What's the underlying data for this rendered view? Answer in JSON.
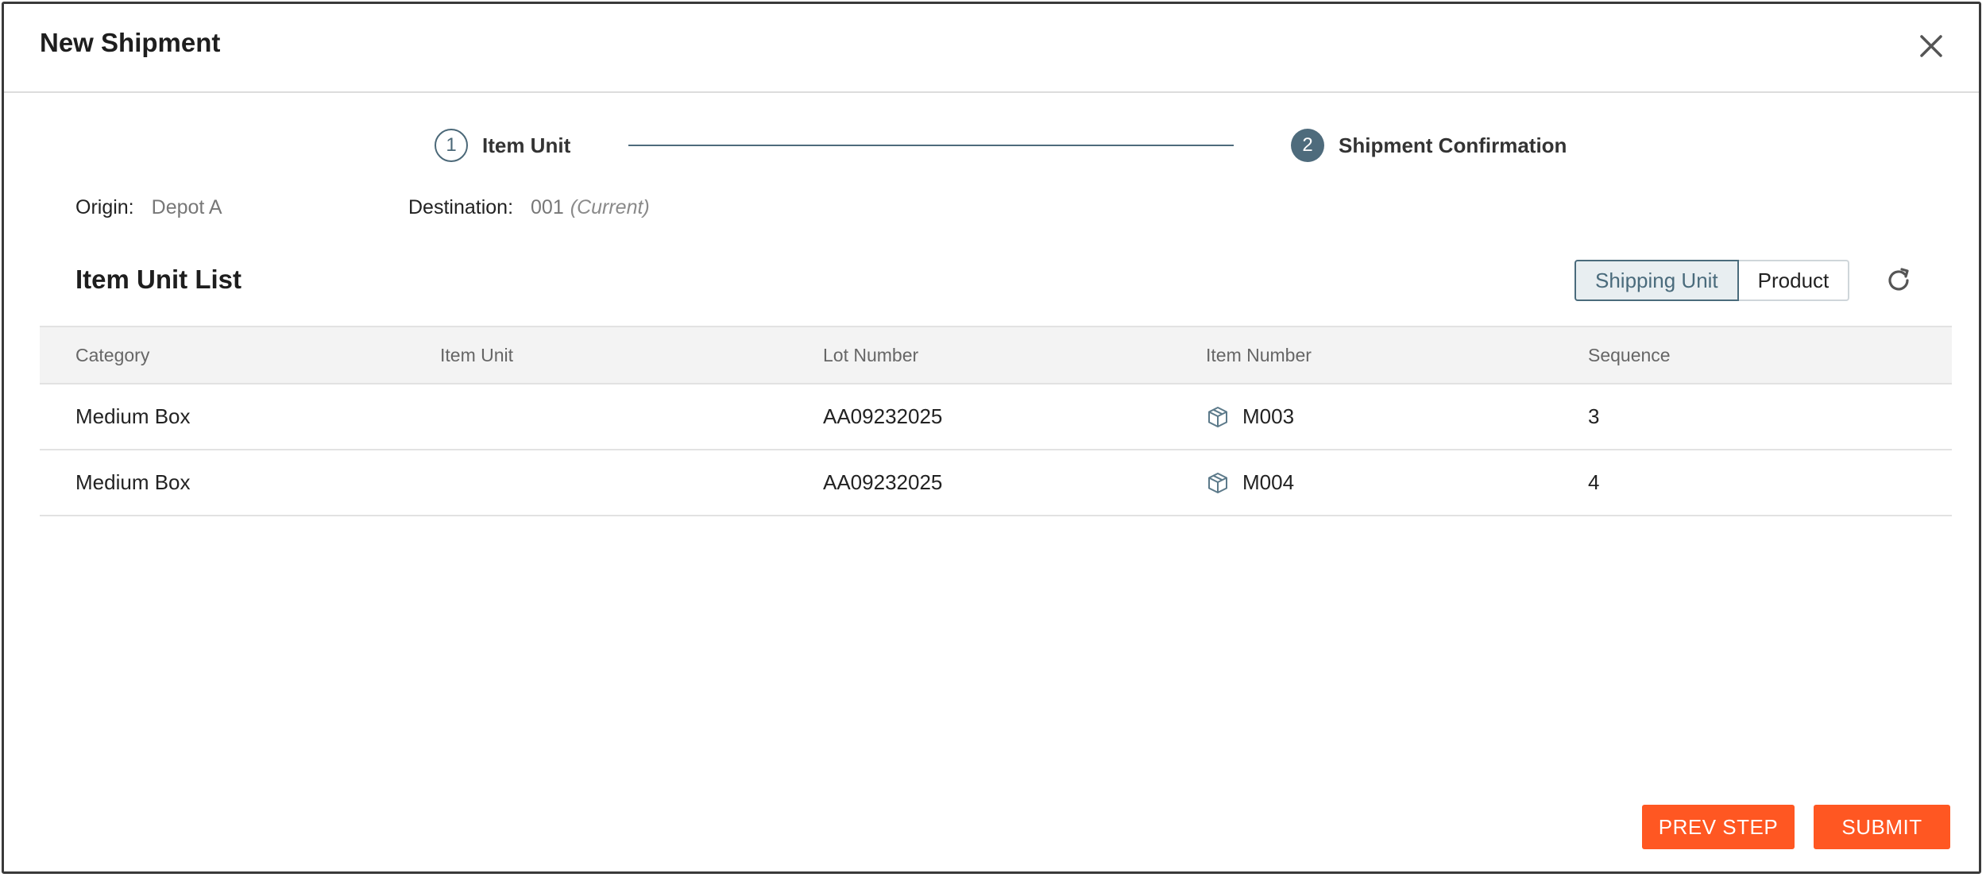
{
  "dialog": {
    "title": "New Shipment"
  },
  "stepper": {
    "steps": [
      {
        "number": "1",
        "label": "Item Unit"
      },
      {
        "number": "2",
        "label": "Shipment Confirmation"
      }
    ]
  },
  "meta": {
    "origin_label": "Origin:",
    "origin_value": "Depot A",
    "destination_label": "Destination:",
    "destination_value": "001",
    "destination_note": "(Current)"
  },
  "list": {
    "title": "Item Unit List",
    "toggle": {
      "options": [
        "Shipping Unit",
        "Product"
      ],
      "selected": "Shipping Unit"
    }
  },
  "table": {
    "columns": [
      "Category",
      "Item Unit",
      "Lot Number",
      "Item Number",
      "Sequence"
    ],
    "rows": [
      {
        "category": "Medium Box",
        "item_unit": "",
        "lot_number": "AA09232025",
        "item_number": "M003",
        "sequence": "3"
      },
      {
        "category": "Medium Box",
        "item_unit": "",
        "lot_number": "AA09232025",
        "item_number": "M004",
        "sequence": "4"
      }
    ]
  },
  "footer": {
    "prev_label": "PREV STEP",
    "submit_label": "SUBMIT"
  },
  "colors": {
    "accent": "#ff5722",
    "step": "#4e6b7c",
    "toggle_active": "#4a6b7c"
  },
  "icons": {
    "close": "close-icon",
    "refresh": "refresh-icon",
    "item": "box-icon"
  }
}
